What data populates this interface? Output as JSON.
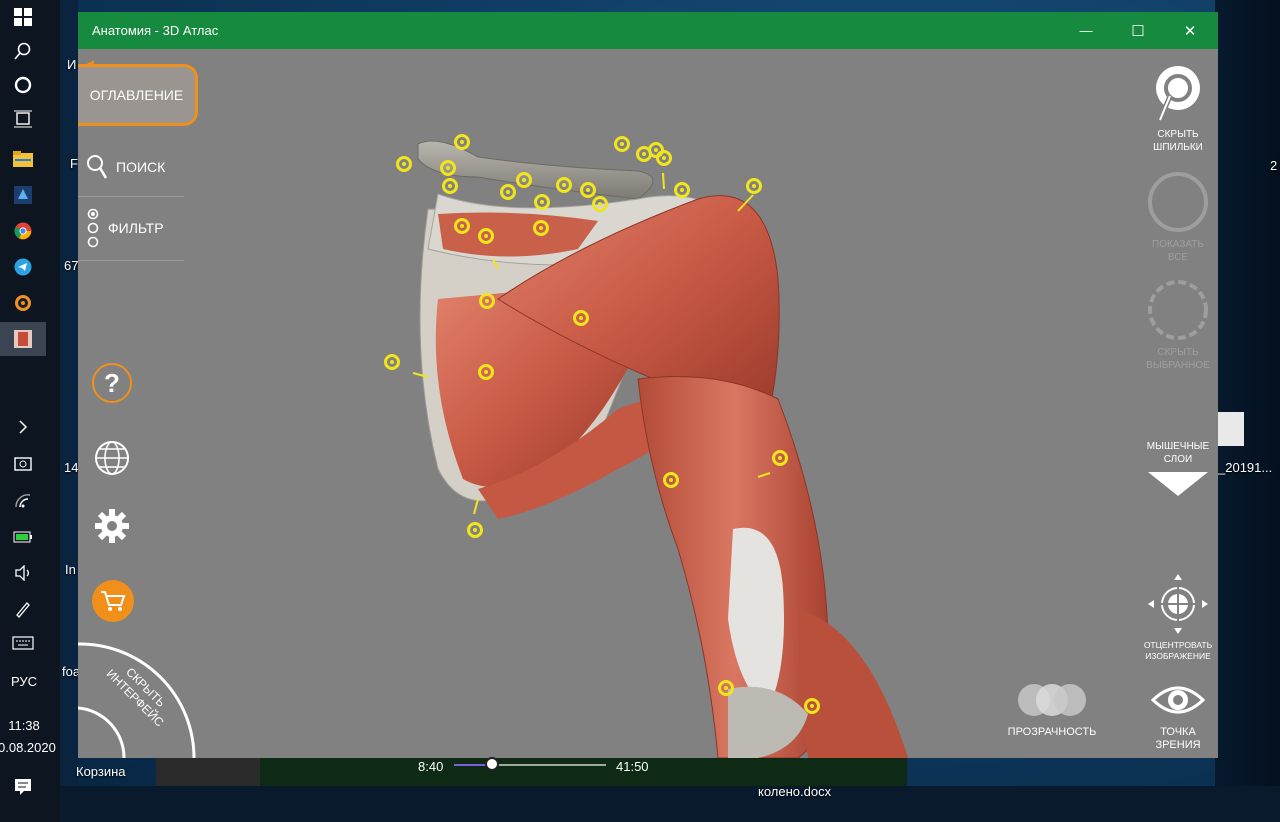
{
  "window": {
    "title": "Анатомия - 3D Атлас",
    "minimize_glyph": "—",
    "maximize_glyph": "☐",
    "close_glyph": "✕"
  },
  "left_menu": {
    "toc_label": "ОГЛАВЛЕНИЕ",
    "search_label": "ПОИСК",
    "filter_label": "ФИЛЬТР",
    "hide_ui_label_line1": "СКРЫТЬ",
    "hide_ui_label_line2": "ИНТЕРФЕЙС",
    "accent_color": "#f0901a"
  },
  "right_panel": {
    "hide_pins": [
      "СКРЫТЬ",
      "ШПИЛЬКИ"
    ],
    "show_all": [
      "ПОКАЗАТЬ",
      "ВСЕ"
    ],
    "hide_selected": [
      "СКРЫТЬ",
      "ВЫБРАННОЕ"
    ],
    "muscle_layers": [
      "МЫШЕЧНЫЕ",
      "СЛОИ"
    ],
    "center_image": [
      "ОТЦЕНТРОВАТЬ",
      "ИЗОБРАЖЕНИЕ"
    ],
    "transparency": "ПРОЗРАЧНОСТЬ",
    "viewpoint": [
      "ТОЧКА",
      "ЗРЕНИЯ"
    ]
  },
  "taskbar": {
    "language": "РУС",
    "time": "11:38",
    "date": "0.08.2020"
  },
  "desktop": {
    "labels": [
      "И",
      "F",
      "67",
      "14",
      "In",
      "foa",
      "2",
      "_20191...",
      "Корзина",
      "колено.docx"
    ]
  },
  "media": {
    "current_time": "8:40",
    "total_time": "41:50",
    "progress_fraction": 0.25
  },
  "pin_color": "#f2e51c",
  "titlebar_color": "#168a3f"
}
